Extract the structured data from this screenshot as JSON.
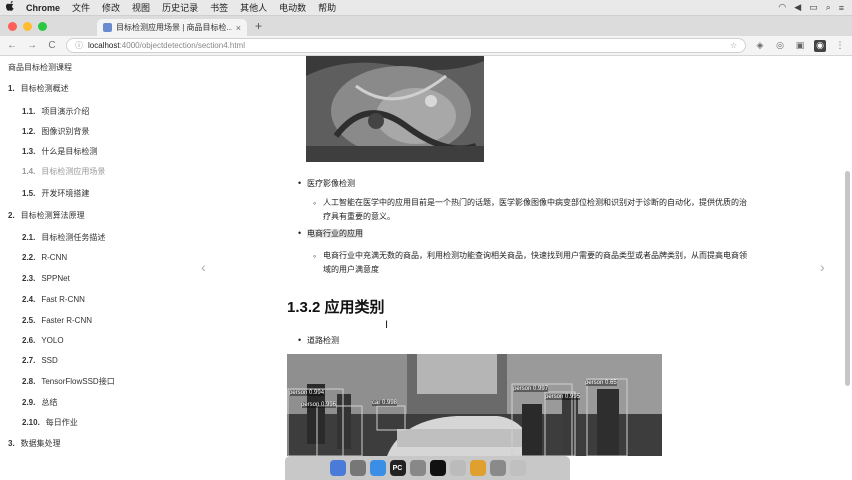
{
  "menubar": {
    "apple": "",
    "items": [
      "Chrome",
      "文件",
      "修改",
      "视图",
      "历史记录",
      "书签",
      "其他人",
      "电动数",
      "帮助"
    ]
  },
  "tab": {
    "title": "目标检测应用场景 | 商品目标检...",
    "close": "×"
  },
  "newtab": "+",
  "toolbar": {
    "back": "←",
    "forward": "→",
    "reload": "C",
    "host": "localhost",
    "port_path": ":4000/objectdetection/section4.html"
  },
  "sidebar": {
    "title": "商品目标检测课程",
    "items": [
      {
        "num": "1.",
        "label": "目标检测概述",
        "level": 1
      },
      {
        "num": "1.1.",
        "label": "项目演示介绍",
        "level": 2
      },
      {
        "num": "1.2.",
        "label": "图像识别背景",
        "level": 2
      },
      {
        "num": "1.3.",
        "label": "什么是目标检测",
        "level": 2
      },
      {
        "num": "1.4.",
        "label": "目标检测应用场景",
        "level": 2
      },
      {
        "num": "1.5.",
        "label": "开发环境搭建",
        "level": 2
      },
      {
        "num": "2.",
        "label": "目标检测算法原理",
        "level": 1
      },
      {
        "num": "2.1.",
        "label": "目标检测任务描述",
        "level": 2
      },
      {
        "num": "2.2.",
        "label": "R-CNN",
        "level": 2
      },
      {
        "num": "2.3.",
        "label": "SPPNet",
        "level": 2
      },
      {
        "num": "2.4.",
        "label": "Fast R-CNN",
        "level": 2
      },
      {
        "num": "2.5.",
        "label": "Faster R-CNN",
        "level": 2
      },
      {
        "num": "2.6.",
        "label": "YOLO",
        "level": 2
      },
      {
        "num": "2.7.",
        "label": "SSD",
        "level": 2
      },
      {
        "num": "2.8.",
        "label": "TensorFlowSSD接口",
        "level": 2
      },
      {
        "num": "2.9.",
        "label": "总结",
        "level": 2
      },
      {
        "num": "2.10.",
        "label": "每日作业",
        "level": 2
      },
      {
        "num": "3.",
        "label": "数据集处理",
        "level": 1
      }
    ],
    "active_index": 4
  },
  "content": {
    "bullet_medical": "医疗影像检测",
    "medical_desc": "人工智能在医学中的应用目前是一个热门的话题，医学影像图像中病变部位检测和识别对于诊断的自动化，提供优质的治疗具有重要的意义。",
    "bullet_ecommerce": "电商行业的应用",
    "ecommerce_desc": "电商行业中充满无数的商品，利用检测功能查询相关商品，快速找到用户需要的商品类型或者品牌类别，从而提高电商领域的用户满意度",
    "section_heading": "1.3.2 应用类别",
    "bullet_road": "道路检测",
    "street_labels": [
      "person 0.994",
      "person 0.996",
      "car 0.998",
      "person 0.65",
      "person 0.997",
      "person 0.995"
    ]
  },
  "colors": {
    "traffic_red": "#ff5f57",
    "traffic_yellow": "#febc2e",
    "traffic_green": "#28c840",
    "detection_box": "#d0d0d0"
  },
  "dock": {
    "icons": [
      "finder-icon",
      "launchpad-icon",
      "safari-icon",
      "pycharm-icon",
      "system-prefs-icon",
      "terminal-icon",
      "textedit-icon",
      "chrome-icon",
      "preview-icon",
      "trash-icon"
    ],
    "pycharm_label": "PC"
  }
}
